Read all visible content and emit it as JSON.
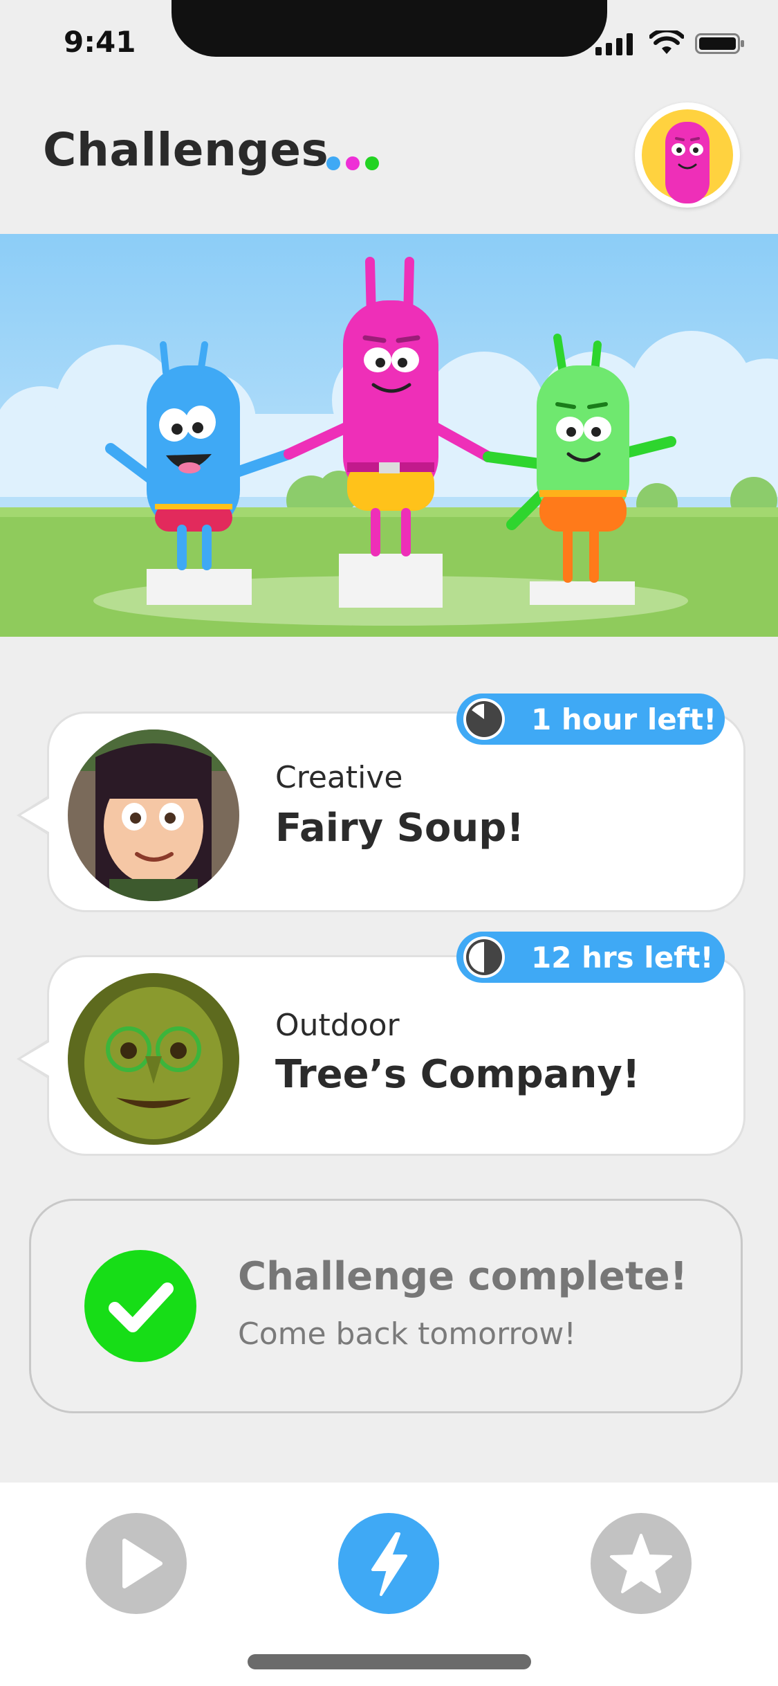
{
  "status_bar": {
    "time": "9:41"
  },
  "header": {
    "title": "Challenges",
    "dot_colors": [
      "#3fa9f5",
      "#ee2fd6",
      "#22d322"
    ]
  },
  "challenges": [
    {
      "category": "Creative",
      "title": "Fairy Soup!",
      "time_left": "1 hour left!",
      "time_elapsed_fraction": 0.85
    },
    {
      "category": "Outdoor",
      "title": "Tree’s Company!",
      "time_left": "12 hrs left!",
      "time_elapsed_fraction": 0.5
    }
  ],
  "completion": {
    "title": "Challenge complete!",
    "subtitle": "Come back tomorrow!"
  },
  "bottom_nav": {
    "items": [
      {
        "name": "play",
        "icon": "play-icon",
        "active": false
      },
      {
        "name": "challenges",
        "icon": "lightning-icon",
        "active": true
      },
      {
        "name": "favorites",
        "icon": "star-icon",
        "active": false
      }
    ]
  },
  "colors": {
    "accent_blue": "#3fa9f5",
    "complete_green": "#17dd17",
    "inactive_gray": "#c2c2c2"
  }
}
